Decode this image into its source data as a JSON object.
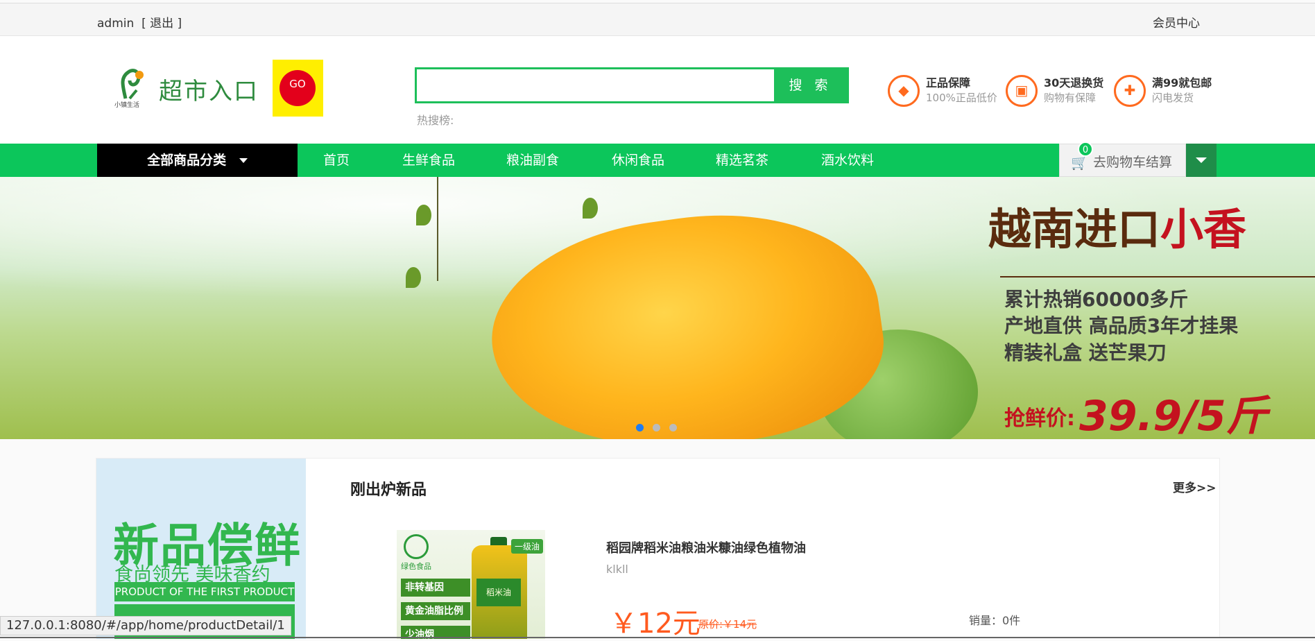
{
  "topbar": {
    "username": "admin",
    "logout": "[ 退出 ]",
    "member_center": "会员中心"
  },
  "header": {
    "brand_name": "超市入口",
    "brand_small": "小镇生活",
    "go_badge": "GO",
    "search": {
      "value": "",
      "placeholder": "",
      "button": "搜 索"
    },
    "hot_search_label": "热搜榜:",
    "promos": [
      {
        "icon": "diamond-icon",
        "title": "正品保障",
        "subtitle": "100%正品低价"
      },
      {
        "icon": "box-icon",
        "title": "30天退换货",
        "subtitle": "购物有保障"
      },
      {
        "icon": "gift-icon",
        "title": "满99就包邮",
        "subtitle": "闪电发货"
      }
    ]
  },
  "nav": {
    "all_categories": "全部商品分类",
    "items": [
      "首页",
      "生鲜食品",
      "粮油副食",
      "休闲食品",
      "精选茗茶",
      "酒水饮料"
    ],
    "cart": {
      "label": "去购物车结算",
      "count": "0"
    }
  },
  "banner": {
    "headline_part1": "越南进口",
    "headline_part2": "小香",
    "lines": [
      "累计热销60000多斤",
      "产地直供 高品质3年才挂果",
      "精装礼盒 送芒果刀"
    ],
    "price_label": "抢鲜价:",
    "price_value": "39.9/5斤",
    "slides_total": 3,
    "active_slide": 1
  },
  "new_products": {
    "ad": {
      "big": "新品偿鲜",
      "sub": "食尚领先 美味香约",
      "band": "PRODUCT OF THE FIRST PRODUCT"
    },
    "title": "刚出炉新品",
    "more": "更多>>",
    "product": {
      "image_tag": "一级油",
      "image_logo": "绿色食品",
      "image_strips": [
        "非转基因",
        "黄金油脂比例",
        "少油烟"
      ],
      "bottle_label": "稻米油",
      "name": "稻园牌稻米油粮油米糠油绿色植物油",
      "desc": "klkll",
      "price": "￥12元",
      "original_price": "原价:￥14元",
      "sales": "销量：0件"
    }
  },
  "status_bar": {
    "url": "127.0.0.1:8080/#/app/home/productDetail/1"
  },
  "colors": {
    "brand_green": "#0cc65b",
    "price_orange": "#ff5a1f",
    "active_dot": "#1e7cf2"
  }
}
